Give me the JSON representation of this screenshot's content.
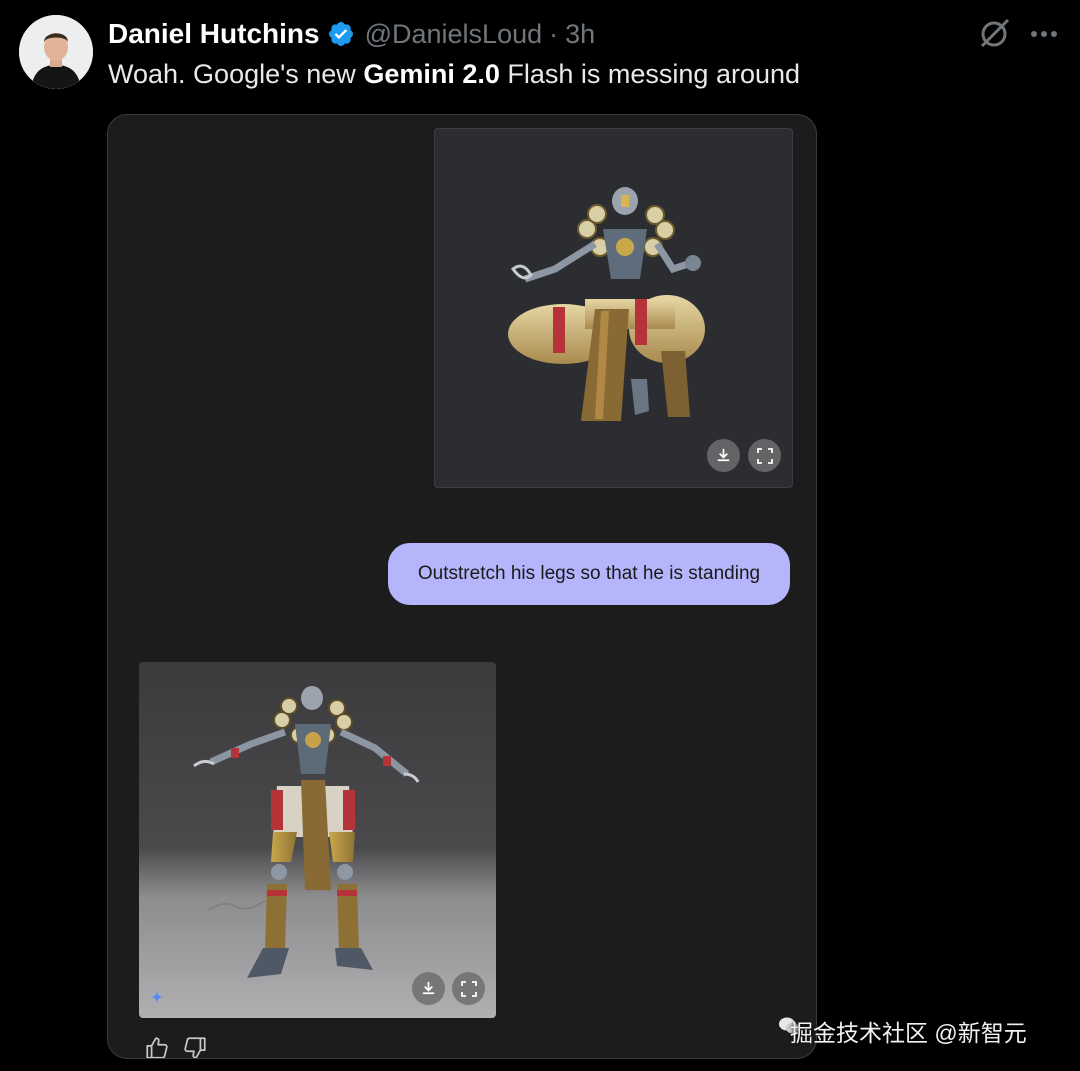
{
  "author": {
    "name": "Daniel Hutchins",
    "handle": "@DanielsLoud",
    "separator": "·",
    "time": "3h"
  },
  "tweet": {
    "text_before": "Woah. Google's new ",
    "text_bold": "Gemini 2.0",
    "text_after": " Flash is messing around"
  },
  "chat": {
    "user_message": "Outstretch his legs so that he is standing"
  },
  "icons": {
    "verified": "verified-badge-icon",
    "grok": "grok-icon",
    "more": "more-icon",
    "download": "download-icon",
    "fullscreen": "fullscreen-icon",
    "thumbs_up": "thumbs-up-icon",
    "thumbs_down": "thumbs-down-icon",
    "gemini": "gemini-star-icon"
  },
  "colors": {
    "background": "#000000",
    "verified": "#1d9bf0",
    "bubble": "#b5b5fb",
    "handle": "#71767b"
  },
  "watermark": "掘金技术社区 @新智元"
}
